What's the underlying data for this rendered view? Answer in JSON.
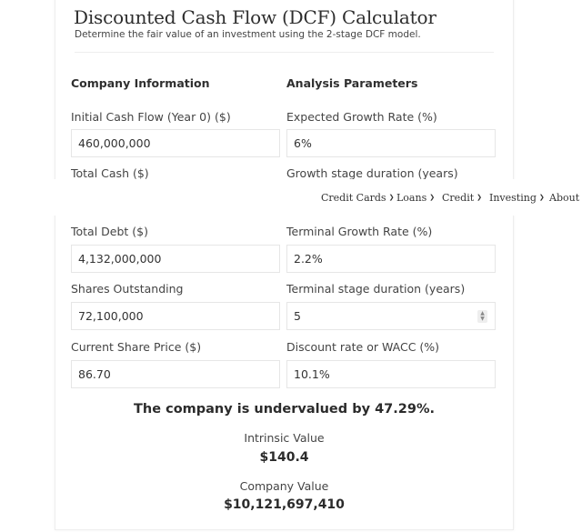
{
  "calculator": {
    "title": "Discounted Cash Flow (DCF) Calculator",
    "subtitle": "Determine the fair value of an investment using the 2-stage DCF model."
  },
  "sections": {
    "company": "Company Information",
    "analysis": "Analysis Parameters"
  },
  "fields": {
    "initial_cash_flow": {
      "label": "Initial Cash Flow (Year 0) ($)",
      "value": "460,000,000"
    },
    "total_cash": {
      "label": "Total Cash ($)",
      "value": ""
    },
    "total_debt": {
      "label": "Total Debt ($)",
      "value": "4,132,000,000"
    },
    "shares_outstanding": {
      "label": "Shares Outstanding",
      "value": "72,100,000"
    },
    "share_price": {
      "label": "Current Share Price ($)",
      "value": "86.70"
    },
    "growth_rate": {
      "label": "Expected Growth Rate (%)",
      "value": "6%"
    },
    "growth_duration": {
      "label": "Growth stage duration (years)",
      "value": ""
    },
    "terminal_growth": {
      "label": "Terminal Growth Rate (%)",
      "value": "2.2%"
    },
    "terminal_duration": {
      "label": "Terminal stage duration (years)",
      "value": "5"
    },
    "discount_rate": {
      "label": "Discount rate or WACC (%)",
      "value": "10.1%"
    }
  },
  "nav": {
    "items": [
      {
        "label": "Credit Cards",
        "icon": "chevron-down-icon"
      },
      {
        "label": "Loans",
        "icon": "chevron-down-icon"
      },
      {
        "label": "Credit",
        "icon": "chevron-down-icon"
      },
      {
        "label": "Investing",
        "icon": "chevron-down-icon"
      },
      {
        "label": "About U"
      }
    ]
  },
  "results": {
    "verdict": "The company is undervalued by 47.29%.",
    "intrinsic_label": "Intrinsic Value",
    "intrinsic_value": "$140.4",
    "company_label": "Company Value",
    "company_value": "$10,121,697,410"
  }
}
